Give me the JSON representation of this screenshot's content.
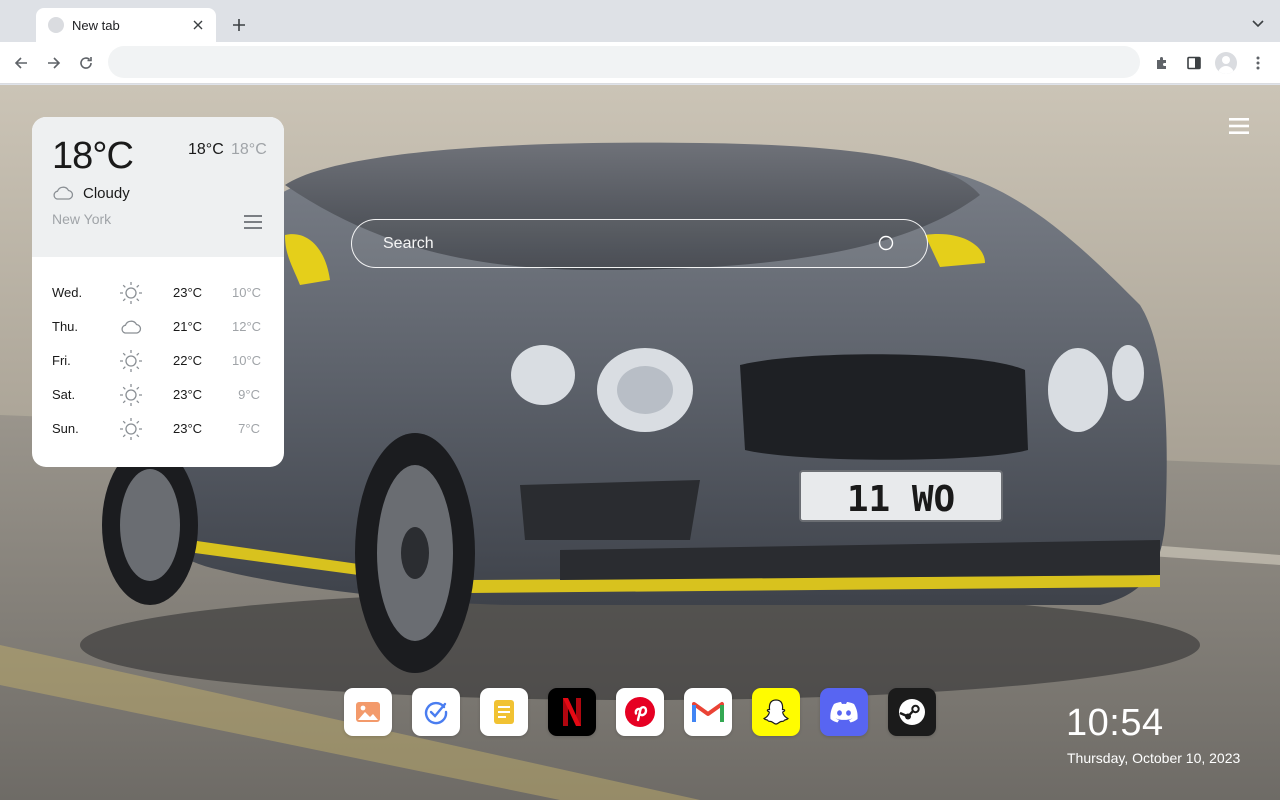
{
  "browser": {
    "tab": {
      "title": "New tab"
    },
    "omnibox": {
      "value": ""
    }
  },
  "weather": {
    "current_temp": "18°C",
    "high": "18°C",
    "low": "18°C",
    "condition": "Cloudy",
    "condition_icon": "cloud-icon",
    "city": "New York",
    "forecast": [
      {
        "day": "Wed.",
        "icon": "sun-icon",
        "high": "23°C",
        "low": "10°C"
      },
      {
        "day": "Thu.",
        "icon": "cloud-icon",
        "high": "21°C",
        "low": "12°C"
      },
      {
        "day": "Fri.",
        "icon": "sun-icon",
        "high": "22°C",
        "low": "10°C"
      },
      {
        "day": "Sat.",
        "icon": "sun-icon",
        "high": "23°C",
        "low": "9°C"
      },
      {
        "day": "Sun.",
        "icon": "sun-icon",
        "high": "23°C",
        "low": "7°C"
      }
    ]
  },
  "search": {
    "placeholder": "Search"
  },
  "wallpaper": {
    "plate_text": "11 WO"
  },
  "dock": {
    "apps": [
      {
        "name": "gallery",
        "icon": "image-icon",
        "color": "#f08a5d"
      },
      {
        "name": "tasks",
        "icon": "check-circle-icon",
        "color": "#4a7df0"
      },
      {
        "name": "notes",
        "icon": "note-icon",
        "color": "#f1c232"
      },
      {
        "name": "netflix",
        "icon": "netflix-icon",
        "color": "#e50914"
      },
      {
        "name": "pinterest",
        "icon": "pinterest-icon",
        "color": "#e60023"
      },
      {
        "name": "gmail",
        "icon": "gmail-icon",
        "color": "#ea4335"
      },
      {
        "name": "snapchat",
        "icon": "snapchat-icon",
        "color": "#fffc00"
      },
      {
        "name": "discord",
        "icon": "discord-icon",
        "color": "#5865f2"
      },
      {
        "name": "steam",
        "icon": "steam-icon",
        "color": "#1b1b1b"
      }
    ]
  },
  "clock": {
    "time": "10:54",
    "date": "Thursday, October 10, 2023"
  }
}
